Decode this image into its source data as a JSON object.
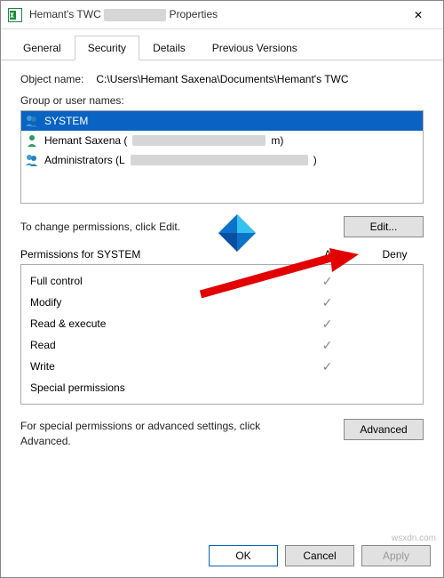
{
  "window": {
    "title_prefix": "Hemant's TWC",
    "title_suffix": "Properties",
    "close_glyph": "✕"
  },
  "tabs": {
    "general": "General",
    "security": "Security",
    "details": "Details",
    "previous": "Previous Versions"
  },
  "body": {
    "object_name_label": "Object name:",
    "object_name_value": "C:\\Users\\Hemant Saxena\\Documents\\Hemant's TWC",
    "group_label": "Group or user names:",
    "groups": {
      "system": "SYSTEM",
      "user_prefix": "Hemant Saxena (",
      "user_suffix": "m)",
      "admins_prefix": "Administrators (L",
      "admins_suffix": ")"
    },
    "change_hint": "To change permissions, click Edit.",
    "edit_btn": "Edit...",
    "perm_label": "Permissions for SYSTEM",
    "allow": "Allow",
    "deny": "Deny",
    "perms": {
      "full": "Full control",
      "modify": "Modify",
      "readex": "Read & execute",
      "read": "Read",
      "write": "Write",
      "special": "Special permissions"
    },
    "checks": {
      "full_allow": "✓",
      "full_deny": "",
      "modify_allow": "✓",
      "modify_deny": "",
      "readex_allow": "✓",
      "readex_deny": "",
      "read_allow": "✓",
      "read_deny": "",
      "write_allow": "✓",
      "write_deny": "",
      "special_allow": "",
      "special_deny": ""
    },
    "adv_text": "For special permissions or advanced settings, click Advanced.",
    "adv_btn": "Advanced"
  },
  "buttons": {
    "ok": "OK",
    "cancel": "Cancel",
    "apply": "Apply"
  },
  "watermark": "wsxdn.com"
}
